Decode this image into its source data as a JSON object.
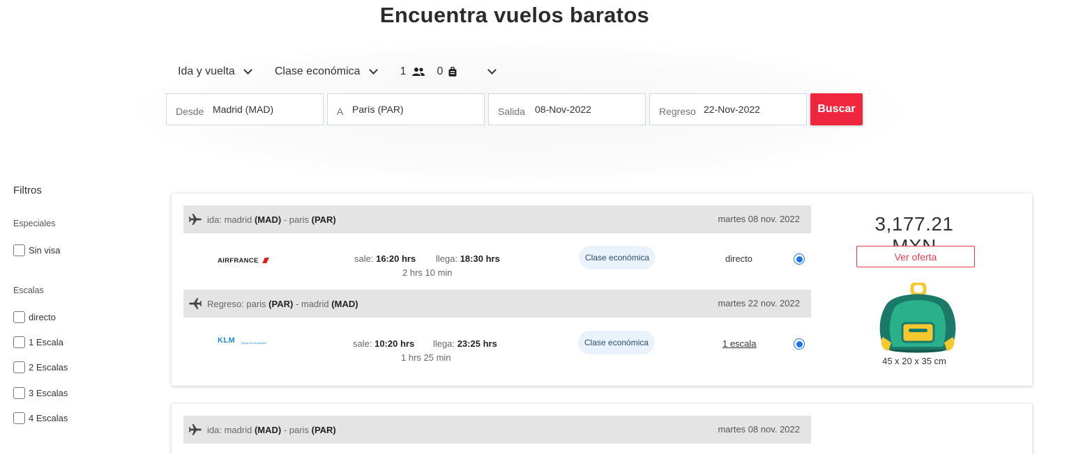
{
  "header": {
    "title": "Encuentra vuelos baratos"
  },
  "search": {
    "trip_type": "Ida y vuelta",
    "cabin_class": "Clase económica",
    "passengers": "1",
    "bags": "0",
    "from_label": "Desde",
    "from_value": "Madrid (MAD)",
    "to_label": "A",
    "to_value": "París (PAR)",
    "depart_label": "Salida",
    "depart_value": "08-Nov-2022",
    "return_label": "Regreso",
    "return_value": "22-Nov-2022",
    "button_label": "Buscar"
  },
  "filters": {
    "title": "Filtros",
    "special_section": "Especiales",
    "special_options": [
      "Sin visa"
    ],
    "stops_section": "Escalas",
    "stops_options": [
      "directo",
      "1 Escala",
      "2 Escalas",
      "3 Escalas",
      "4 Escalas"
    ]
  },
  "results": [
    {
      "price": "3,177.21 MXN",
      "offer_label": "Ver oferta",
      "bag_dimensions": "45 x 20 x 35 cm",
      "outbound": {
        "prefix": "ida: madrid",
        "origin_code": "(MAD)",
        "dash": "-",
        "dest_name": "paris",
        "dest_code": "(PAR)",
        "date": "martes 08 nov. 2022",
        "airline": "AIRFRANCE",
        "depart_label": "sale:",
        "depart_time": "16:20 hrs",
        "arrive_label": "llega:",
        "arrive_time": "18:30 hrs",
        "duration": "2 hrs 10 min",
        "class": "Clase económica",
        "stops": "directo"
      },
      "inbound": {
        "prefix": "Regreso: paris",
        "origin_code": "(PAR)",
        "dash": "-",
        "dest_name": "madrid",
        "dest_code": "(MAD)",
        "date": "martes 22 nov. 2022",
        "airline": "KLM",
        "airline_sub": "Royal Dutch Airlines",
        "depart_label": "sale:",
        "depart_time": "10:20 hrs",
        "arrive_label": "llega:",
        "arrive_time": "23:25 hrs",
        "duration": "1 hrs 25 min",
        "class": "Clase económica",
        "stops": "1 escala"
      }
    },
    {
      "outbound": {
        "prefix": "ida: madrid",
        "origin_code": "(MAD)",
        "dash": "-",
        "dest_name": "paris",
        "dest_code": "(PAR)",
        "date": "martes 08 nov. 2022"
      }
    }
  ],
  "colors": {
    "accent": "#f0263e",
    "radio": "#1a73e8",
    "bag_green": "#1b7a67",
    "bag_yellow": "#f5c830"
  }
}
